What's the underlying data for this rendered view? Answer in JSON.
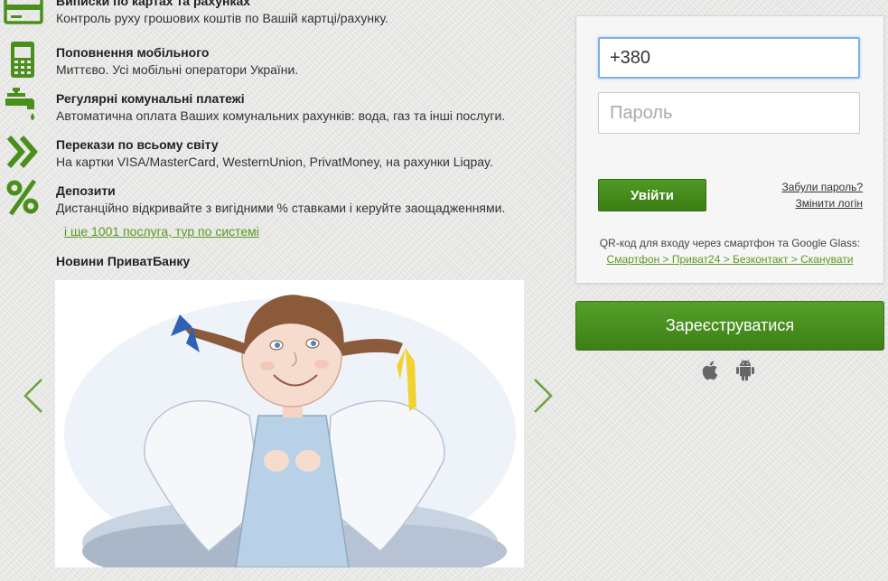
{
  "services": [
    {
      "icon": "card-icon",
      "title": "Виписки по картах та рахунках",
      "desc": "Контроль руху грошових коштів по Вашій картці/рахунку."
    },
    {
      "icon": "mobile-phone-icon",
      "title": "Поповнення мобільного",
      "desc": "Миттєво. Усі мобільні оператори України."
    },
    {
      "icon": "water-tap-icon",
      "title": "Регулярні комунальні платежі",
      "desc": "Автоматична оплата Ваших комунальних рахунків: вода, газ та інші послуги."
    },
    {
      "icon": "double-chevron-icon",
      "title": "Перекази по всьому світу",
      "desc": "На картки VISA/MasterCard, WesternUnion, PrivatMoney, на рахунки Liqpay."
    },
    {
      "icon": "percent-icon",
      "title": "Депозити",
      "desc": "Дистанційно відкривайте з вигідними % ставками і керуйте заощадженнями."
    }
  ],
  "more_link": "і ще 1001 послуга, тур по системі",
  "news_title": "Новини ПриватБанку",
  "login": {
    "phone_value": "+380",
    "password_placeholder": "Пароль",
    "login_button": "Увійти",
    "forgot_password": "Забули пароль?",
    "change_login": "Змінити логін",
    "qr_text": "QR-код для входу через смартфон та Google Glass:",
    "qr_link": "Смартфон > Приват24 > Безконтакт > Сканувати"
  },
  "register_button": "Зареєструватися",
  "platforms": [
    "apple-icon",
    "android-icon"
  ],
  "colors": {
    "accent_green": "#4a9522",
    "link_green": "#5b9a21",
    "icon_green": "#4a8f1c"
  }
}
